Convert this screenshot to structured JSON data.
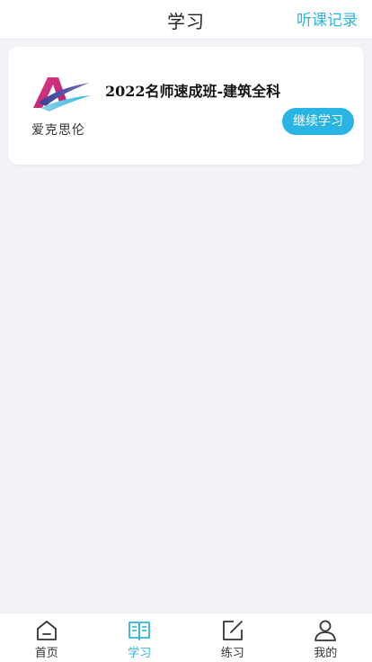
{
  "header": {
    "title": "学习",
    "action_label": "听课记录"
  },
  "courses": [
    {
      "logo_text": "爱克思伦",
      "title": "2022名师速成班-建筑全科",
      "button_label": "继续学习"
    }
  ],
  "tabbar": {
    "active": "学习",
    "active_color": "#2fb5dc",
    "items": [
      {
        "label": "首页",
        "icon": "home-icon"
      },
      {
        "label": "学习",
        "icon": "book-icon"
      },
      {
        "label": "练习",
        "icon": "edit-icon"
      },
      {
        "label": "我的",
        "icon": "user-icon"
      }
    ]
  }
}
